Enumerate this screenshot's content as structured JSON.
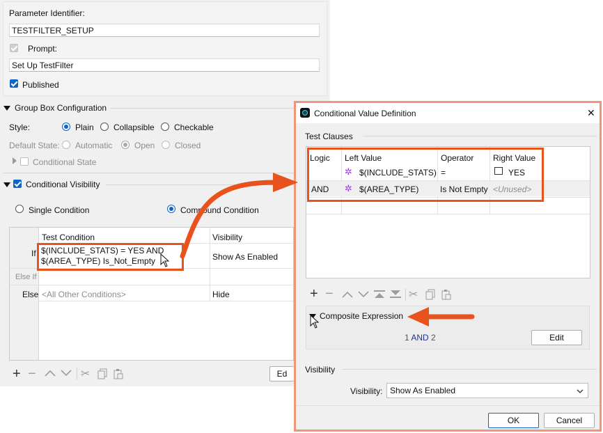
{
  "param": {
    "identifier_label": "Parameter Identifier:",
    "identifier_value": "TESTFILTER_SETUP",
    "prompt_label": "Prompt:",
    "prompt_value": "Set Up TestFilter",
    "published_label": "Published"
  },
  "group_box": {
    "title": "Group Box Configuration",
    "style_label": "Style:",
    "style_options": [
      "Plain",
      "Collapsible",
      "Checkable"
    ],
    "default_state_label": "Default State:",
    "state_options": [
      "Automatic",
      "Open",
      "Closed"
    ],
    "conditional_state_label": "Conditional State"
  },
  "visibility": {
    "title": "Conditional Visibility",
    "single_label": "Single Condition",
    "compound_label": "Compound Condition",
    "col_condition": "Test Condition",
    "col_visibility": "Visibility",
    "rows": [
      {
        "label": "If",
        "condition": "$(INCLUDE_STATS) = YES AND\n$(AREA_TYPE) Is_Not_Empty",
        "visibility": "Show As Enabled"
      },
      {
        "label": "Else If",
        "condition": "",
        "visibility": ""
      },
      {
        "label": "Else",
        "condition": "<All Other Conditions>",
        "visibility": "Hide"
      }
    ],
    "edit_label": "Ed"
  },
  "dialog": {
    "title": "Conditional Value Definition",
    "close_glyph": "✕",
    "test_clauses_label": "Test Clauses",
    "headers": [
      "Logic",
      "Left Value",
      "Operator",
      "Right Value"
    ],
    "clauses": [
      {
        "logic": "",
        "left": "$(INCLUDE_STATS)",
        "operator": "=",
        "right": "YES"
      },
      {
        "logic": "AND",
        "left": "$(AREA_TYPE)",
        "operator": "Is Not Empty",
        "right": "<Unused>"
      }
    ],
    "composite_label": "Composite Expression",
    "expr_a": "1",
    "expr_op": "AND",
    "expr_b": "2",
    "edit_label": "Edit",
    "visibility_section": "Visibility",
    "visibility_label": "Visibility:",
    "visibility_value": "Show As Enabled",
    "ok_label": "OK",
    "cancel_label": "Cancel"
  },
  "colors": {
    "accent": "#0b66c8",
    "annotation": "#e8521d",
    "dialog_border": "#ef967a"
  }
}
